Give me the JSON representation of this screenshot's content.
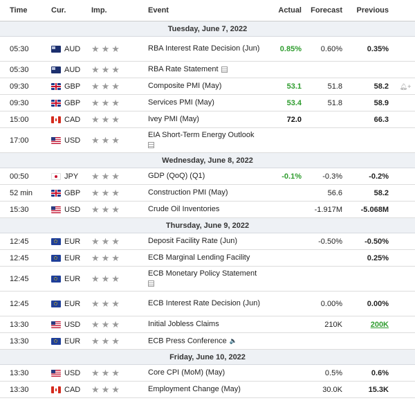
{
  "headers": {
    "time": "Time",
    "cur": "Cur.",
    "imp": "Imp.",
    "event": "Event",
    "actual": "Actual",
    "forecast": "Forecast",
    "previous": "Previous"
  },
  "rows": [
    {
      "type": "day",
      "label": "Tuesday, June 7, 2022"
    },
    {
      "time": "05:30",
      "flag": "aud-flag-icon",
      "cur": "AUD",
      "event": "RBA Interest Rate Decision (Jun)",
      "actual": "0.85%",
      "actual_color": "green",
      "forecast": "0.60%",
      "previous": "0.35%",
      "tall": true
    },
    {
      "time": "05:30",
      "flag": "aud-flag-icon",
      "cur": "AUD",
      "event": "RBA Rate Statement",
      "doc_icon": true,
      "actual": "",
      "forecast": "",
      "previous": ""
    },
    {
      "time": "09:30",
      "flag": "gbp-flag-icon",
      "cur": "GBP",
      "event": "Composite PMI (May)",
      "actual": "53.1",
      "actual_color": "green",
      "forecast": "51.8",
      "previous": "58.2",
      "bell_icon": true
    },
    {
      "time": "09:30",
      "flag": "gbp-flag-icon",
      "cur": "GBP",
      "event": "Services PMI (May)",
      "actual": "53.4",
      "actual_color": "green",
      "forecast": "51.8",
      "previous": "58.9"
    },
    {
      "time": "15:00",
      "flag": "cad-flag-icon",
      "cur": "CAD",
      "event": "Ivey PMI (May)",
      "actual": "72.0",
      "actual_color": "black",
      "forecast": "",
      "previous": "66.3"
    },
    {
      "time": "17:00",
      "flag": "usd-flag-icon",
      "cur": "USD",
      "event": "EIA Short-Term Energy Outlook",
      "doc_icon_newline": true,
      "actual": "",
      "forecast": "",
      "previous": "",
      "tall": true
    },
    {
      "type": "day",
      "label": "Wednesday, June 8, 2022"
    },
    {
      "time": "00:50",
      "flag": "jpy-flag-icon",
      "cur": "JPY",
      "event": "GDP (QoQ) (Q1)",
      "actual": "-0.1%",
      "actual_color": "green",
      "forecast": "-0.3%",
      "previous": "-0.2%"
    },
    {
      "time": "52 min",
      "flag": "gbp-flag-icon",
      "cur": "GBP",
      "event": "Construction PMI (May)",
      "actual": "",
      "forecast": "56.6",
      "previous": "58.2"
    },
    {
      "time": "15:30",
      "flag": "usd-flag-icon",
      "cur": "USD",
      "event": "Crude Oil Inventories",
      "actual": "",
      "forecast": "-1.917M",
      "previous": "-5.068M"
    },
    {
      "type": "day",
      "label": "Thursday, June 9, 2022"
    },
    {
      "time": "12:45",
      "flag": "eur-flag-icon",
      "cur": "EUR",
      "event": "Deposit Facility Rate (Jun)",
      "actual": "",
      "forecast": "-0.50%",
      "previous": "-0.50%"
    },
    {
      "time": "12:45",
      "flag": "eur-flag-icon",
      "cur": "EUR",
      "event": "ECB Marginal Lending Facility",
      "actual": "",
      "forecast": "",
      "previous": "0.25%"
    },
    {
      "time": "12:45",
      "flag": "eur-flag-icon",
      "cur": "EUR",
      "event": "ECB Monetary Policy Statement",
      "doc_icon_newline": true,
      "actual": "",
      "forecast": "",
      "previous": "",
      "tall": true
    },
    {
      "time": "12:45",
      "flag": "eur-flag-icon",
      "cur": "EUR",
      "event": "ECB Interest Rate Decision (Jun)",
      "actual": "",
      "forecast": "0.00%",
      "previous": "0.00%",
      "tall": true
    },
    {
      "time": "13:30",
      "flag": "usd-flag-icon",
      "cur": "USD",
      "event": "Initial Jobless Claims",
      "actual": "",
      "forecast": "210K",
      "previous": "200K",
      "previous_color": "green"
    },
    {
      "time": "13:30",
      "flag": "eur-flag-icon",
      "cur": "EUR",
      "event": "ECB Press Conference",
      "speaker_icon": true,
      "actual": "",
      "forecast": "",
      "previous": ""
    },
    {
      "type": "day",
      "label": "Friday, June 10, 2022"
    },
    {
      "time": "13:30",
      "flag": "usd-flag-icon",
      "cur": "USD",
      "event": "Core CPI (MoM) (May)",
      "actual": "",
      "forecast": "0.5%",
      "previous": "0.6%"
    },
    {
      "time": "13:30",
      "flag": "cad-flag-icon",
      "cur": "CAD",
      "event": "Employment Change (May)",
      "actual": "",
      "forecast": "30.0K",
      "previous": "15.3K"
    }
  ],
  "stars": "★★★",
  "colors": {
    "green": "#2e9c2e",
    "day_bg": "#eef1f5",
    "star": "#9a9a9a"
  }
}
